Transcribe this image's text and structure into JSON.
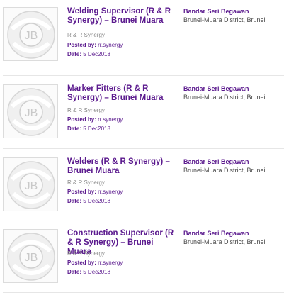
{
  "jobs": [
    {
      "title": "Welding Supervisor (R & R Synergy) – Brunei Muara",
      "company": "R & R Synergy",
      "posted_label": "Posted by:",
      "posted_by": "rr.synergy",
      "date_label": "Date:",
      "date": "5 Dec2018",
      "city": "Bandar Seri Begawan",
      "region": "Brunei-Muara District, Brunei",
      "logo_text": "JB"
    },
    {
      "title": "Marker Fitters (R & R Synergy) – Brunei Muara",
      "company": "R & R Synergy",
      "posted_label": "Posted by:",
      "posted_by": "rr.synergy",
      "date_label": "Date:",
      "date": "5 Dec2018",
      "city": "Bandar Seri Begawan",
      "region": "Brunei-Muara District, Brunei",
      "logo_text": "JB"
    },
    {
      "title": "Welders (R & R Synergy) – Brunei Muara",
      "company": "R & R Synergy",
      "posted_label": "Posted by:",
      "posted_by": "rr.synergy",
      "date_label": "Date:",
      "date": "5 Dec2018",
      "city": "Bandar Seri Begawan",
      "region": "Brunei-Muara District, Brunei",
      "logo_text": "JB"
    },
    {
      "title": "Construction Supervisor (R & R Synergy) – Brunei Muara",
      "company": "R & R Synergy",
      "posted_label": "Posted by:",
      "posted_by": "rr.synergy",
      "date_label": "Date:",
      "date": "5 Dec2018",
      "city": "Bandar Seri Begawan",
      "region": "Brunei-Muara District, Brunei",
      "logo_text": "JB"
    }
  ],
  "colors": {
    "accent": "#5b1a8e",
    "muted": "#8a8a8a",
    "divider": "#e6e6e6"
  },
  "icons": {
    "logo": "company-logo-icon"
  }
}
